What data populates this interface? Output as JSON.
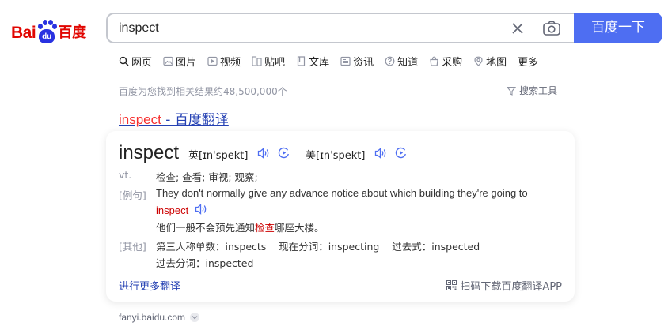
{
  "logo": {
    "text_bai": "Bai",
    "text_du": "du",
    "text_zh": "百度"
  },
  "search": {
    "value": "inspect",
    "button_label": "百度一下"
  },
  "tabs": [
    {
      "label": "网页",
      "icon": "search-icon"
    },
    {
      "label": "图片",
      "icon": "image-icon"
    },
    {
      "label": "视频",
      "icon": "video-icon"
    },
    {
      "label": "贴吧",
      "icon": "tieba-icon"
    },
    {
      "label": "文库",
      "icon": "doc-icon"
    },
    {
      "label": "资讯",
      "icon": "news-icon"
    },
    {
      "label": "知道",
      "icon": "question-icon"
    },
    {
      "label": "采购",
      "icon": "shopping-bag-icon"
    },
    {
      "label": "地图",
      "icon": "map-icon"
    },
    {
      "label": "更多"
    }
  ],
  "results_meta": {
    "count_text": "百度为您找到相关结果约48,500,000个",
    "tools_label": "搜索工具"
  },
  "result": {
    "title_highlight": "inspect",
    "title_rest": " - 百度翻译",
    "word": "inspect",
    "phonetic_uk": "英[ɪnˈspekt]",
    "phonetic_us": "美[ɪnˈspekt]",
    "pos": "vt.",
    "definition": "检查; 查看; 审视; 观察;",
    "example_label": "[例句]",
    "example_en": "They don't normally give any advance notice about which building they're going to",
    "example_en_hl": "inspect",
    "example_zh_pre": "他们一般不会预先通知",
    "example_zh_hl": "检查",
    "example_zh_post": "哪座大楼。",
    "other_label": "[其他]",
    "forms_line1": "第三人称单数：inspects    现在分词：inspecting    过去式：inspected",
    "forms_line2": "过去分词：inspected",
    "more_link": "进行更多翻译",
    "app_link": "扫码下载百度翻译APP",
    "source": "fanyi.baidu.com"
  },
  "colors": {
    "brand_blue": "#4e6ef2",
    "link_blue": "#2440b3",
    "highlight_red": "#f73131",
    "logo_red": "#e10601",
    "paw_blue": "#2932e1"
  }
}
